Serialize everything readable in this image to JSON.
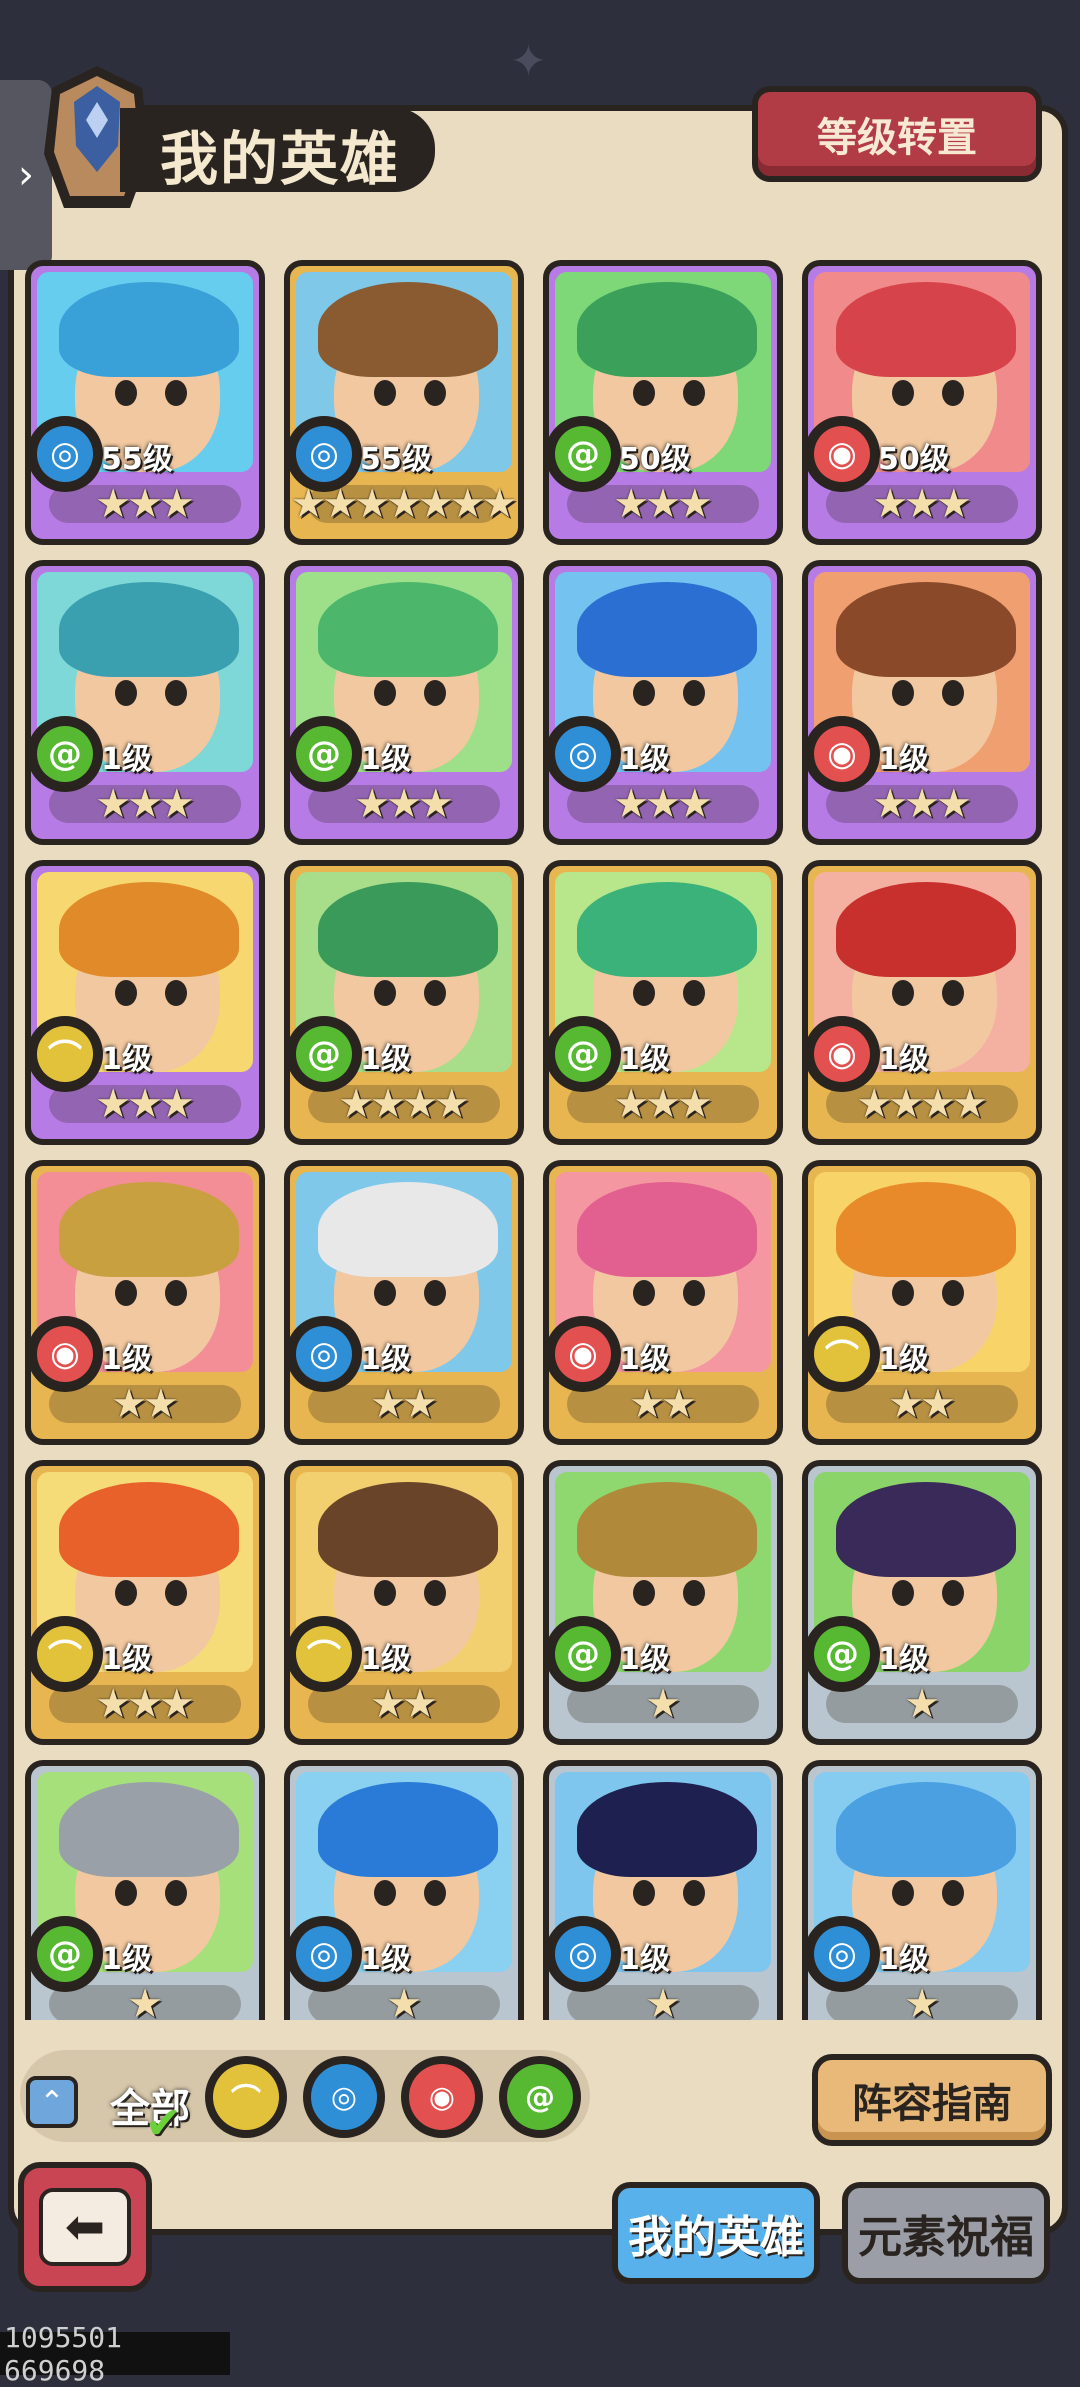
{
  "header": {
    "title": "我的英雄",
    "level_transfer_button": "等级转置",
    "side_tab_icon": "chevron-right-icon"
  },
  "colors": {
    "water": "#2f8fd6",
    "nature": "#57b832",
    "fire": "#e25050",
    "earth": "#e2c23a",
    "purple_frame": "#b77be6",
    "gold_frame": "#e8b651",
    "silver_frame": "#b9c6cf"
  },
  "heroes": [
    {
      "level": "55级",
      "element": "water",
      "stars": 3,
      "frame": "purple",
      "bg": "#66cdee",
      "hair": "#3aa0d8"
    },
    {
      "level": "55级",
      "element": "water",
      "stars": 7,
      "frame": "gold",
      "bg": "#7fc8e8",
      "hair": "#8a5a30"
    },
    {
      "level": "50级",
      "element": "nature",
      "stars": 3,
      "frame": "purple",
      "bg": "#7ed878",
      "hair": "#3aa05a"
    },
    {
      "level": "50级",
      "element": "fire",
      "stars": 3,
      "frame": "purple",
      "bg": "#f18a8a",
      "hair": "#d7434a"
    },
    {
      "level": "1级",
      "element": "nature",
      "stars": 3,
      "frame": "purple",
      "bg": "#7fd8d8",
      "hair": "#3aa0b0"
    },
    {
      "level": "1级",
      "element": "nature",
      "stars": 3,
      "frame": "purple",
      "bg": "#9ee08a",
      "hair": "#4cb66a"
    },
    {
      "level": "1级",
      "element": "water",
      "stars": 3,
      "frame": "purple",
      "bg": "#73c2ef",
      "hair": "#2a6fd1"
    },
    {
      "level": "1级",
      "element": "fire",
      "stars": 3,
      "frame": "purple",
      "bg": "#f0a070",
      "hair": "#8a4a2a"
    },
    {
      "level": "1级",
      "element": "earth",
      "stars": 3,
      "frame": "purple",
      "bg": "#f7d870",
      "hair": "#e08a2a"
    },
    {
      "level": "1级",
      "element": "nature",
      "stars": 4,
      "frame": "gold",
      "bg": "#a8dd8a",
      "hair": "#3a9a5a"
    },
    {
      "level": "1级",
      "element": "nature",
      "stars": 3,
      "frame": "gold",
      "bg": "#b8e68a",
      "hair": "#3ab27a"
    },
    {
      "level": "1级",
      "element": "fire",
      "stars": 4,
      "frame": "gold",
      "bg": "#f4b0a0",
      "hair": "#c8302e"
    },
    {
      "level": "1级",
      "element": "fire",
      "stars": 2,
      "frame": "gold",
      "bg": "#f38e96",
      "hair": "#c8a040"
    },
    {
      "level": "1级",
      "element": "water",
      "stars": 2,
      "frame": "gold",
      "bg": "#80c8ea",
      "hair": "#e8e8e8"
    },
    {
      "level": "1级",
      "element": "fire",
      "stars": 2,
      "frame": "gold",
      "bg": "#f497a0",
      "hair": "#e26090"
    },
    {
      "level": "1级",
      "element": "earth",
      "stars": 2,
      "frame": "gold",
      "bg": "#f8d468",
      "hair": "#e88a2a"
    },
    {
      "level": "1级",
      "element": "earth",
      "stars": 3,
      "frame": "gold",
      "bg": "#f6dc78",
      "hair": "#e8602a"
    },
    {
      "level": "1级",
      "element": "earth",
      "stars": 2,
      "frame": "gold",
      "bg": "#f2d070",
      "hair": "#6a4428"
    },
    {
      "level": "1级",
      "element": "nature",
      "stars": 1,
      "frame": "silver",
      "bg": "#8fd870",
      "hair": "#b08a3a"
    },
    {
      "level": "1级",
      "element": "nature",
      "stars": 1,
      "frame": "silver",
      "bg": "#8ad46a",
      "hair": "#3a2a5a"
    },
    {
      "level": "1级",
      "element": "nature",
      "stars": 1,
      "frame": "silver",
      "bg": "#a6e07a",
      "hair": "#9aa0a8"
    },
    {
      "level": "1级",
      "element": "water",
      "stars": 1,
      "frame": "silver",
      "bg": "#8ad0f0",
      "hair": "#2a7ad8"
    },
    {
      "level": "1级",
      "element": "water",
      "stars": 1,
      "frame": "silver",
      "bg": "#7ec6ee",
      "hair": "#1e2050"
    },
    {
      "level": "1级",
      "element": "water",
      "stars": 1,
      "frame": "silver",
      "bg": "#86cbf0",
      "hair": "#4aa0e0"
    }
  ],
  "filters": {
    "all_label": "全部",
    "items": [
      "earth",
      "water",
      "fire",
      "nature"
    ],
    "collapse_icon": "chevron-up-icon",
    "selected": "全部"
  },
  "lineup_guide_button": "阵容指南",
  "back_button_icon": "back-arrow-icon",
  "tabs": {
    "my_heroes": "我的英雄",
    "element_blessing": "元素祝福"
  },
  "footer_id": "1095501 669698"
}
